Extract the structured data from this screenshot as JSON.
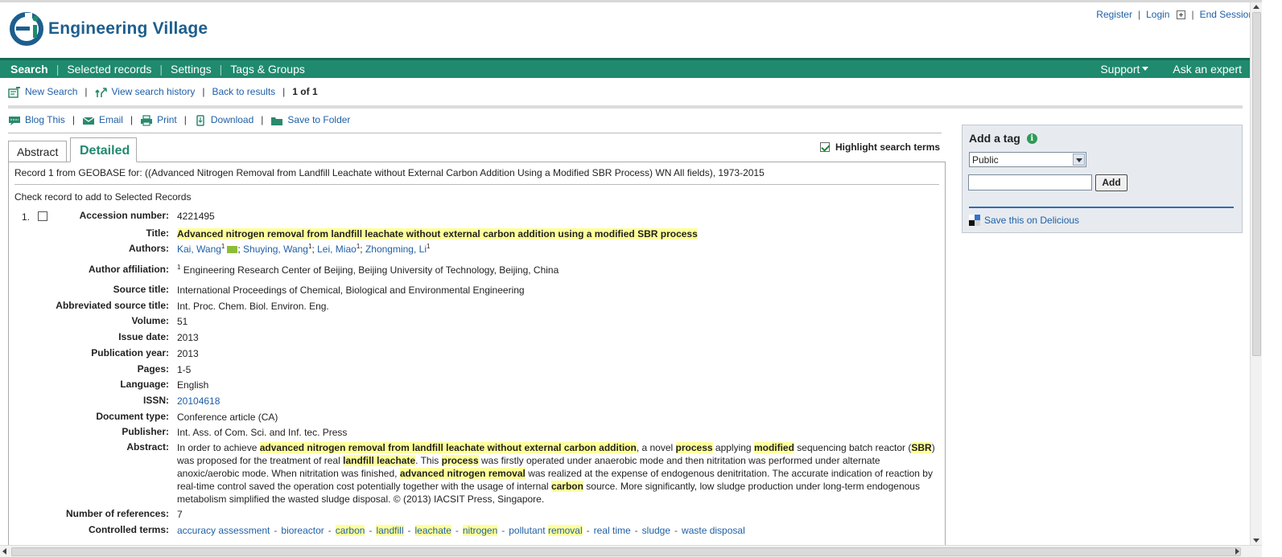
{
  "brand": {
    "name": "Engineering Village",
    "color": "#1f8a6e",
    "logo_color": "#1d5e8e"
  },
  "top_links": {
    "register": "Register",
    "login": "Login",
    "end_session": "End Session"
  },
  "nav": {
    "search": "Search",
    "selected_records": "Selected records",
    "settings": "Settings",
    "tags_groups": "Tags & Groups",
    "support": "Support",
    "ask_expert": "Ask an expert"
  },
  "crumbs": {
    "new_search": "New Search",
    "history": "View search history",
    "back": "Back to results",
    "count": "1 of 1"
  },
  "tools": {
    "blog": "Blog This",
    "email": "Email",
    "print": "Print",
    "download": "Download",
    "save_folder": "Save to Folder"
  },
  "tabs": {
    "abstract": "Abstract",
    "detailed": "Detailed"
  },
  "highlight_toggle": {
    "label": "Highlight search terms",
    "checked": true
  },
  "record_header": "Record 1 from GEOBASE for: ((Advanced Nitrogen Removal from Landfill Leachate without External Carbon Addition Using a Modified SBR Process) WN All fields), 1973-2015",
  "check_prompt": "Check record to add to Selected Records",
  "record": {
    "number": "1.",
    "labels": {
      "accession": "Accession number:",
      "title": "Title:",
      "authors": "Authors:",
      "affiliation": "Author affiliation:",
      "source_title": "Source title:",
      "abbrev_source": "Abbreviated source title:",
      "volume": "Volume:",
      "issue_date": "Issue date:",
      "pub_year": "Publication year:",
      "pages": "Pages:",
      "language": "Language:",
      "issn": "ISSN:",
      "doc_type": "Document type:",
      "publisher": "Publisher:",
      "abstract": "Abstract:",
      "num_refs": "Number of references:",
      "controlled_terms": "Controlled terms:"
    },
    "accession": "4221495",
    "title": "Advanced nitrogen removal from landfill leachate without external carbon addition using a modified SBR process",
    "authors": [
      {
        "name": "Kai, Wang",
        "sup": "1",
        "email": true,
        "sep": ""
      },
      {
        "name": "Shuying, Wang",
        "sup": "1",
        "sep": "; "
      },
      {
        "name": "Lei, Miao",
        "sup": "1",
        "sep": "; "
      },
      {
        "name": "Zhongming, Li",
        "sup": "1",
        "sep": "; "
      }
    ],
    "affiliation_sup": "1",
    "affiliation": "Engineering Research Center of Beijing, Beijing University of Technology, Beijing, China",
    "source_title": "International Proceedings of Chemical, Biological and Environmental Engineering",
    "abbrev_source": "Int. Proc. Chem. Biol. Environ. Eng.",
    "volume": "51",
    "issue_date": "2013",
    "pub_year": "2013",
    "pages": "1-5",
    "language": "English",
    "issn": "20104618",
    "doc_type": "Conference article (CA)",
    "publisher": "Int. Ass. of Com. Sci. and Inf. tec. Press",
    "abstract_segments": [
      {
        "t": "In order to achieve ",
        "h": false
      },
      {
        "t": "advanced nitrogen removal from landfill leachate without external carbon addition",
        "h": true
      },
      {
        "t": ", a novel ",
        "h": false
      },
      {
        "t": "process",
        "h": true
      },
      {
        "t": " applying ",
        "h": false
      },
      {
        "t": "modified",
        "h": true
      },
      {
        "t": " sequencing batch reactor (",
        "h": false
      },
      {
        "t": "SBR",
        "h": true
      },
      {
        "t": ") was proposed for the treatment of real ",
        "h": false
      },
      {
        "t": "landfill leachate",
        "h": true
      },
      {
        "t": ". This ",
        "h": false
      },
      {
        "t": "process",
        "h": true
      },
      {
        "t": " was firstly operated under anaerobic mode and then nitritation was performed under alternate anoxic/aerobic mode. When nitritation was finished, ",
        "h": false
      },
      {
        "t": "advanced nitrogen removal",
        "h": true
      },
      {
        "t": " was realized at the expense of endogenous denitritation. The accurate indication of reaction by real-time control saved the operation cost potentially together with the usage of internal ",
        "h": false
      },
      {
        "t": "carbon",
        "h": true
      },
      {
        "t": " source. More significantly, low sludge production under long-term endogenous metabolism simplified the wasted sludge disposal. © (2013) IACSIT Press, Singapore.",
        "h": false
      }
    ],
    "num_refs": "7",
    "controlled_terms": [
      {
        "pre": "accuracy assessment",
        "hl": "",
        "post": ""
      },
      {
        "pre": "bioreactor",
        "hl": "",
        "post": ""
      },
      {
        "pre": "",
        "hl": "carbon",
        "post": ""
      },
      {
        "pre": "",
        "hl": "landfill",
        "post": ""
      },
      {
        "pre": "",
        "hl": "leachate",
        "post": ""
      },
      {
        "pre": "",
        "hl": "nitrogen",
        "post": ""
      },
      {
        "pre": "pollutant ",
        "hl": "removal",
        "post": ""
      },
      {
        "pre": "real time",
        "hl": "",
        "post": ""
      },
      {
        "pre": "sludge",
        "hl": "",
        "post": ""
      },
      {
        "pre": "waste disposal",
        "hl": "",
        "post": ""
      }
    ]
  },
  "sidebar": {
    "add_tag_title": "Add a tag",
    "visibility_selected": "Public",
    "tag_input_value": "",
    "add_button": "Add",
    "delicious": "Save this on Delicious"
  }
}
